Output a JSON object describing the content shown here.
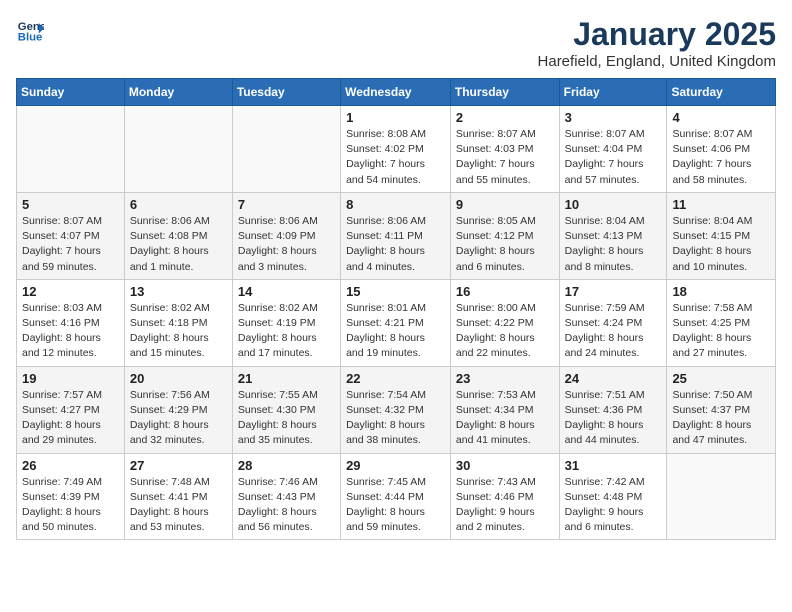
{
  "header": {
    "logo_line1": "General",
    "logo_line2": "Blue",
    "month": "January 2025",
    "location": "Harefield, England, United Kingdom"
  },
  "weekdays": [
    "Sunday",
    "Monday",
    "Tuesday",
    "Wednesday",
    "Thursday",
    "Friday",
    "Saturday"
  ],
  "weeks": [
    [
      {
        "day": "",
        "info": ""
      },
      {
        "day": "",
        "info": ""
      },
      {
        "day": "",
        "info": ""
      },
      {
        "day": "1",
        "info": "Sunrise: 8:08 AM\nSunset: 4:02 PM\nDaylight: 7 hours\nand 54 minutes."
      },
      {
        "day": "2",
        "info": "Sunrise: 8:07 AM\nSunset: 4:03 PM\nDaylight: 7 hours\nand 55 minutes."
      },
      {
        "day": "3",
        "info": "Sunrise: 8:07 AM\nSunset: 4:04 PM\nDaylight: 7 hours\nand 57 minutes."
      },
      {
        "day": "4",
        "info": "Sunrise: 8:07 AM\nSunset: 4:06 PM\nDaylight: 7 hours\nand 58 minutes."
      }
    ],
    [
      {
        "day": "5",
        "info": "Sunrise: 8:07 AM\nSunset: 4:07 PM\nDaylight: 7 hours\nand 59 minutes."
      },
      {
        "day": "6",
        "info": "Sunrise: 8:06 AM\nSunset: 4:08 PM\nDaylight: 8 hours\nand 1 minute."
      },
      {
        "day": "7",
        "info": "Sunrise: 8:06 AM\nSunset: 4:09 PM\nDaylight: 8 hours\nand 3 minutes."
      },
      {
        "day": "8",
        "info": "Sunrise: 8:06 AM\nSunset: 4:11 PM\nDaylight: 8 hours\nand 4 minutes."
      },
      {
        "day": "9",
        "info": "Sunrise: 8:05 AM\nSunset: 4:12 PM\nDaylight: 8 hours\nand 6 minutes."
      },
      {
        "day": "10",
        "info": "Sunrise: 8:04 AM\nSunset: 4:13 PM\nDaylight: 8 hours\nand 8 minutes."
      },
      {
        "day": "11",
        "info": "Sunrise: 8:04 AM\nSunset: 4:15 PM\nDaylight: 8 hours\nand 10 minutes."
      }
    ],
    [
      {
        "day": "12",
        "info": "Sunrise: 8:03 AM\nSunset: 4:16 PM\nDaylight: 8 hours\nand 12 minutes."
      },
      {
        "day": "13",
        "info": "Sunrise: 8:02 AM\nSunset: 4:18 PM\nDaylight: 8 hours\nand 15 minutes."
      },
      {
        "day": "14",
        "info": "Sunrise: 8:02 AM\nSunset: 4:19 PM\nDaylight: 8 hours\nand 17 minutes."
      },
      {
        "day": "15",
        "info": "Sunrise: 8:01 AM\nSunset: 4:21 PM\nDaylight: 8 hours\nand 19 minutes."
      },
      {
        "day": "16",
        "info": "Sunrise: 8:00 AM\nSunset: 4:22 PM\nDaylight: 8 hours\nand 22 minutes."
      },
      {
        "day": "17",
        "info": "Sunrise: 7:59 AM\nSunset: 4:24 PM\nDaylight: 8 hours\nand 24 minutes."
      },
      {
        "day": "18",
        "info": "Sunrise: 7:58 AM\nSunset: 4:25 PM\nDaylight: 8 hours\nand 27 minutes."
      }
    ],
    [
      {
        "day": "19",
        "info": "Sunrise: 7:57 AM\nSunset: 4:27 PM\nDaylight: 8 hours\nand 29 minutes."
      },
      {
        "day": "20",
        "info": "Sunrise: 7:56 AM\nSunset: 4:29 PM\nDaylight: 8 hours\nand 32 minutes."
      },
      {
        "day": "21",
        "info": "Sunrise: 7:55 AM\nSunset: 4:30 PM\nDaylight: 8 hours\nand 35 minutes."
      },
      {
        "day": "22",
        "info": "Sunrise: 7:54 AM\nSunset: 4:32 PM\nDaylight: 8 hours\nand 38 minutes."
      },
      {
        "day": "23",
        "info": "Sunrise: 7:53 AM\nSunset: 4:34 PM\nDaylight: 8 hours\nand 41 minutes."
      },
      {
        "day": "24",
        "info": "Sunrise: 7:51 AM\nSunset: 4:36 PM\nDaylight: 8 hours\nand 44 minutes."
      },
      {
        "day": "25",
        "info": "Sunrise: 7:50 AM\nSunset: 4:37 PM\nDaylight: 8 hours\nand 47 minutes."
      }
    ],
    [
      {
        "day": "26",
        "info": "Sunrise: 7:49 AM\nSunset: 4:39 PM\nDaylight: 8 hours\nand 50 minutes."
      },
      {
        "day": "27",
        "info": "Sunrise: 7:48 AM\nSunset: 4:41 PM\nDaylight: 8 hours\nand 53 minutes."
      },
      {
        "day": "28",
        "info": "Sunrise: 7:46 AM\nSunset: 4:43 PM\nDaylight: 8 hours\nand 56 minutes."
      },
      {
        "day": "29",
        "info": "Sunrise: 7:45 AM\nSunset: 4:44 PM\nDaylight: 8 hours\nand 59 minutes."
      },
      {
        "day": "30",
        "info": "Sunrise: 7:43 AM\nSunset: 4:46 PM\nDaylight: 9 hours\nand 2 minutes."
      },
      {
        "day": "31",
        "info": "Sunrise: 7:42 AM\nSunset: 4:48 PM\nDaylight: 9 hours\nand 6 minutes."
      },
      {
        "day": "",
        "info": ""
      }
    ]
  ]
}
